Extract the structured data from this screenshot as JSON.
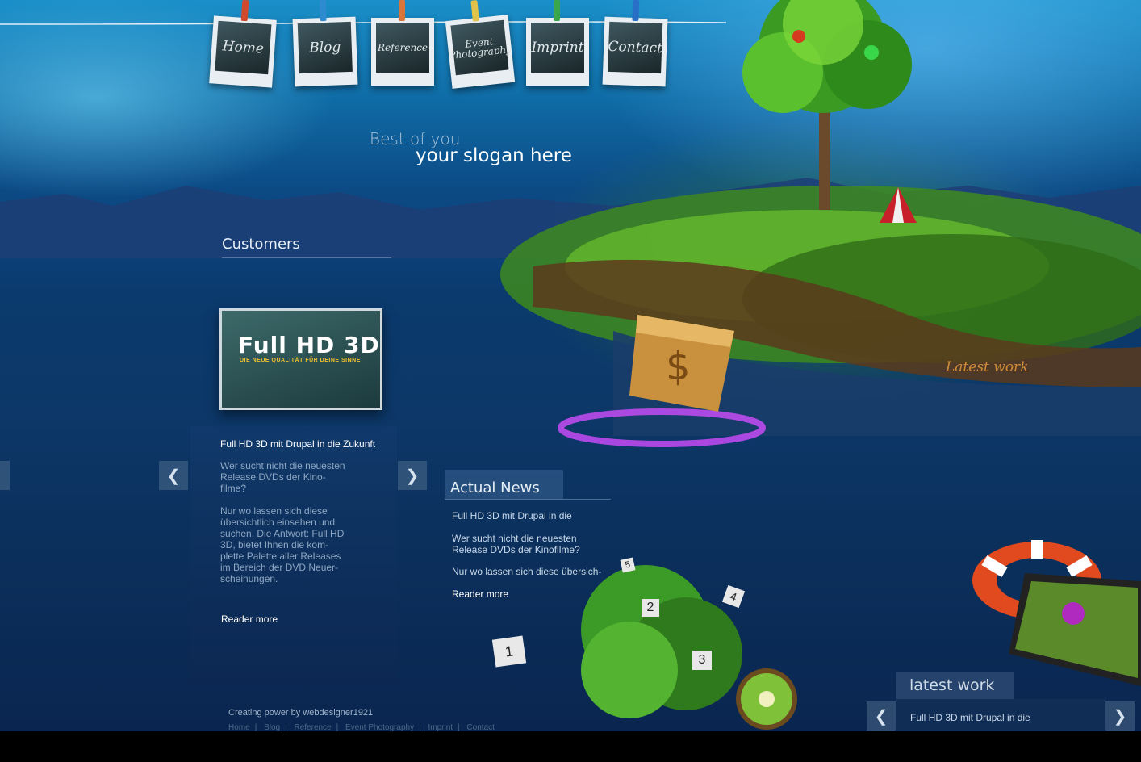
{
  "nav": {
    "items": [
      {
        "label": "Home",
        "peg": "#d0492e"
      },
      {
        "label": "Blog",
        "peg": "#2f8bd0"
      },
      {
        "label": "Reference",
        "peg": "#d8763a"
      },
      {
        "label": "Event Photography",
        "peg": "#e0c34a"
      },
      {
        "label": "Imprint",
        "peg": "#3aa84a"
      },
      {
        "label": "Contact",
        "peg": "#2a6fc7"
      }
    ]
  },
  "slogan": {
    "small": "Best of you",
    "main": "your slogan  here"
  },
  "customers": {
    "heading": "Customers",
    "card_title": "Full HD 3D",
    "card_subtitle": "DIE NEUE QUALITÄT FÜR DEINE SINNE",
    "item_title": "Full HD 3D mit Drupal in die Zukunft",
    "para1": [
      "Wer sucht nicht die neuesten",
      "Release DVDs der Kino-",
      "filme?"
    ],
    "para2": [
      "Nur wo lassen sich diese",
      "übersichtlich einsehen und",
      "suchen. Die Antwort: Full HD",
      "3D, bietet Ihnen die kom-",
      "plette Palette aller Releases",
      "im Bereich der DVD Neuer-",
      "scheinungen."
    ],
    "read_more": "Reader more",
    "prev_icon": "❮",
    "next_icon": "❯"
  },
  "news": {
    "heading": "Actual News",
    "title": "Full HD 3D mit Drupal in die",
    "para1": [
      "Wer sucht nicht die neuesten",
      "Release DVDs der Kinofilme?"
    ],
    "para2": "Nur wo lassen sich diese übersich-",
    "read_more": "Reader more"
  },
  "island": {
    "label": "Latest work"
  },
  "bush_tags": [
    "5",
    "2",
    "4",
    "3",
    "1"
  ],
  "latest_work": {
    "heading": "latest work",
    "title": "Full HD 3D mit Drupal in die",
    "prev_icon": "❮",
    "next_icon": "❯"
  },
  "footer": {
    "credit": "Creating power by webdesigner1921",
    "links": [
      "Home",
      "Blog",
      "Reference",
      "Event Photography",
      "Imprint",
      "Contact"
    ],
    "separator": "|"
  }
}
